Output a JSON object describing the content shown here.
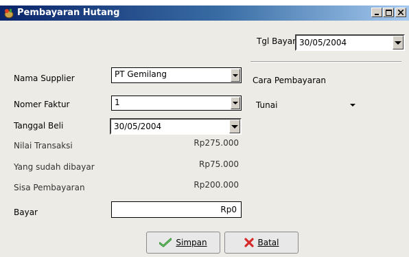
{
  "window": {
    "title": "Pembayaran Hutang",
    "controls": [
      "minimize-icon",
      "maximize-icon",
      "close-icon"
    ]
  },
  "header": {
    "tgl_bayar_label": "Tgl Bayar",
    "tgl_bayar_value": "30/05/2004"
  },
  "form": {
    "nama_supplier_label": "Nama Supplier",
    "nama_supplier_value": "PT Gemilang",
    "nomer_faktur_label": "Nomer Faktur",
    "nomer_faktur_value": "1",
    "tanggal_beli_label": "Tanggal Beli",
    "tanggal_beli_value": "30/05/2004",
    "nilai_transaksi_label": "Nilai Transaksi",
    "nilai_transaksi_value": "Rp275.000",
    "yang_sudah_dibayar_label": "Yang sudah dibayar",
    "yang_sudah_dibayar_value": "Rp75.000",
    "sisa_pembayaran_label": "Sisa Pembayaran",
    "sisa_pembayaran_value": "Rp200.000",
    "bayar_label": "Bayar",
    "bayar_value": "Rp0",
    "cara_pembayaran_label": "Cara Pembayaran",
    "cara_pembayaran_value": "Tunai"
  },
  "buttons": {
    "simpan_label": "Simpan",
    "batal_label": "Batal"
  },
  "colors": {
    "titlebar_start": "#0a246a",
    "titlebar_end": "#a6caf0",
    "window_bg": "#ecebe5"
  }
}
